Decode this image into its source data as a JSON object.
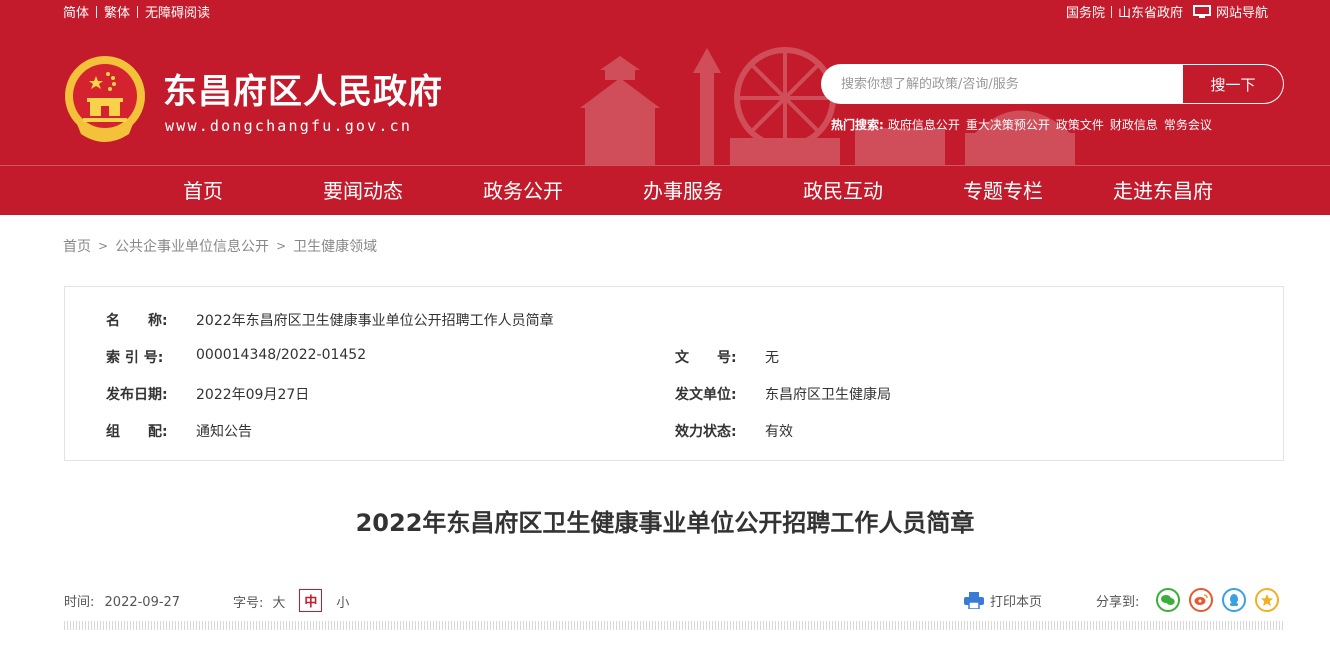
{
  "topbar": {
    "left_links": [
      "简体",
      "繁体",
      "无障碍阅读"
    ],
    "right_links": [
      "国务院",
      "山东省政府"
    ],
    "site_nav": "网站导航"
  },
  "site": {
    "title": "东昌府区人民政府",
    "url": "www.dongchangfu.gov.cn"
  },
  "search": {
    "placeholder": "搜索你想了解的政策/咨询/服务",
    "button": "搜一下",
    "hot_label": "热门搜索:",
    "hot_items": [
      "政府信息公开",
      "重大决策预公开",
      "政策文件",
      "财政信息",
      "常务会议"
    ]
  },
  "nav": [
    "首页",
    "要闻动态",
    "政务公开",
    "办事服务",
    "政民互动",
    "专题专栏",
    "走进东昌府"
  ],
  "breadcrumb": [
    "首页",
    "公共企事业单位信息公开",
    "卫生健康领域"
  ],
  "info": {
    "name_label": "名　　称:",
    "name": "2022年东昌府区卫生健康事业单位公开招聘工作人员简章",
    "index_label": "索 引 号:",
    "index": "000014348/2022-01452",
    "docno_label": "文　　号:",
    "docno": "无",
    "date_label": "发布日期:",
    "date": "2022年09月27日",
    "issuer_label": "发文单位:",
    "issuer": "东昌府区卫生健康局",
    "group_label": "组　　配:",
    "group": "通知公告",
    "status_label": "效力状态:",
    "status": "有效"
  },
  "article": {
    "title": "2022年东昌府区卫生健康事业单位公开招聘工作人员简章",
    "time_label": "时间:",
    "time": "2022-09-27",
    "size_label": "字号:",
    "size_options": [
      "大",
      "中",
      "小"
    ],
    "print": "打印本页",
    "share_label": "分享到:"
  },
  "colors": {
    "brand_red": "#c31b2b"
  }
}
